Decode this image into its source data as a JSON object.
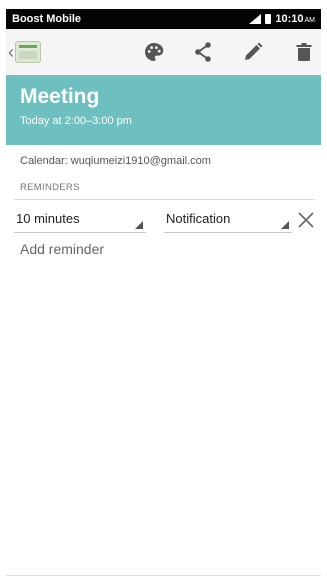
{
  "status_bar": {
    "carrier": "Boost Mobile",
    "time": "10:10",
    "time_suffix": "AM"
  },
  "toolbar": {
    "back_icon": "chevron-left-icon",
    "app_icon": "calendar-app-icon",
    "actions": [
      "palette-icon",
      "share-icon",
      "edit-icon",
      "delete-icon"
    ]
  },
  "event": {
    "title": "Meeting",
    "time": "Today at 2:00–3:00 pm",
    "header_color": "#6dbfc0",
    "calendar": "Calendar: wuqiumeizi1910@gmail.com"
  },
  "reminders": {
    "label": "REMINDERS",
    "items": [
      {
        "time": "10 minutes",
        "method": "Notification"
      }
    ],
    "add_label": "Add reminder"
  }
}
